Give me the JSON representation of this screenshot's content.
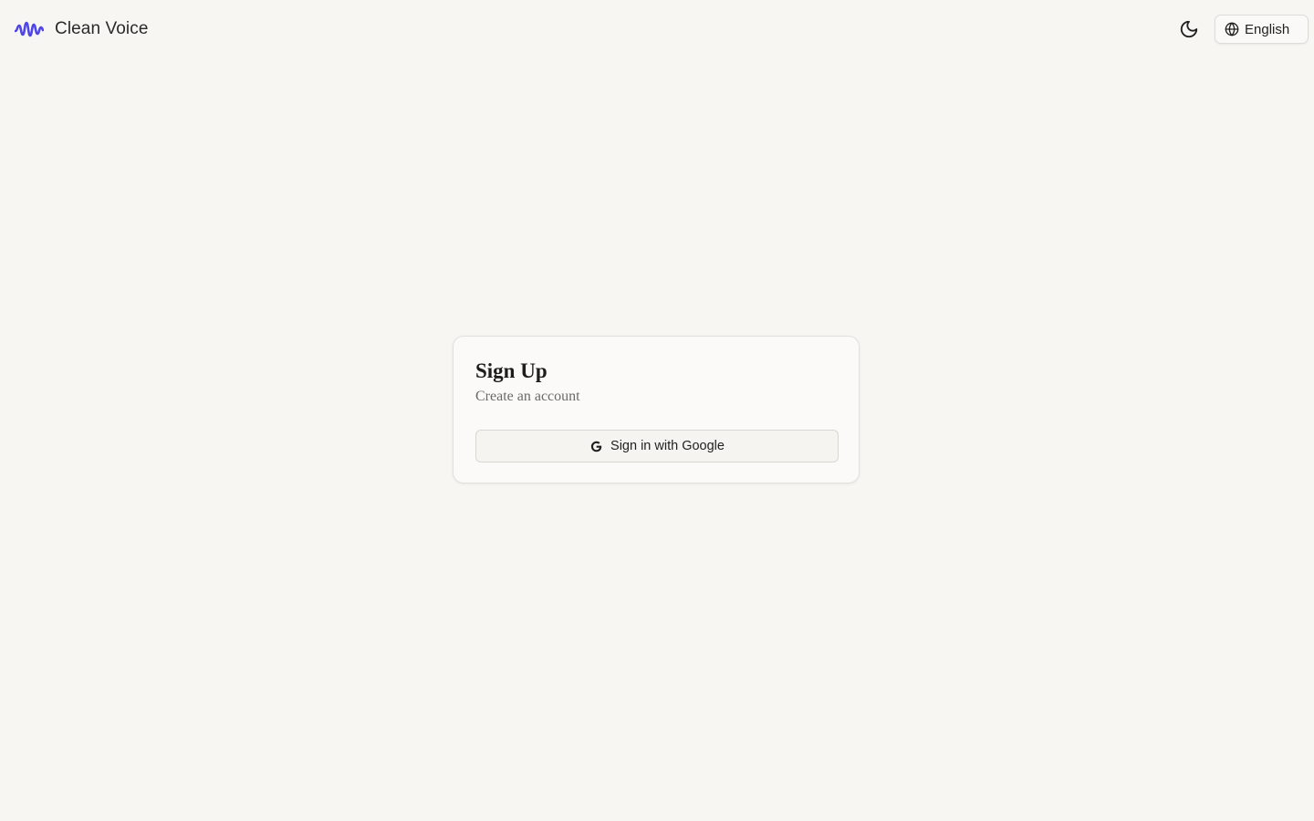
{
  "header": {
    "brand_name": "Clean Voice",
    "brand_icon": "waveform-icon",
    "theme_toggle_icon": "moon-icon",
    "language": {
      "icon": "globe-icon",
      "selected": "English"
    }
  },
  "signup": {
    "title": "Sign Up",
    "subtitle": "Create an account",
    "google_button": {
      "icon": "google-icon",
      "label": "Sign in with Google"
    }
  },
  "colors": {
    "background": "#f7f6f3",
    "accent": "#4f46e5",
    "card_background": "#fbfaf8"
  }
}
